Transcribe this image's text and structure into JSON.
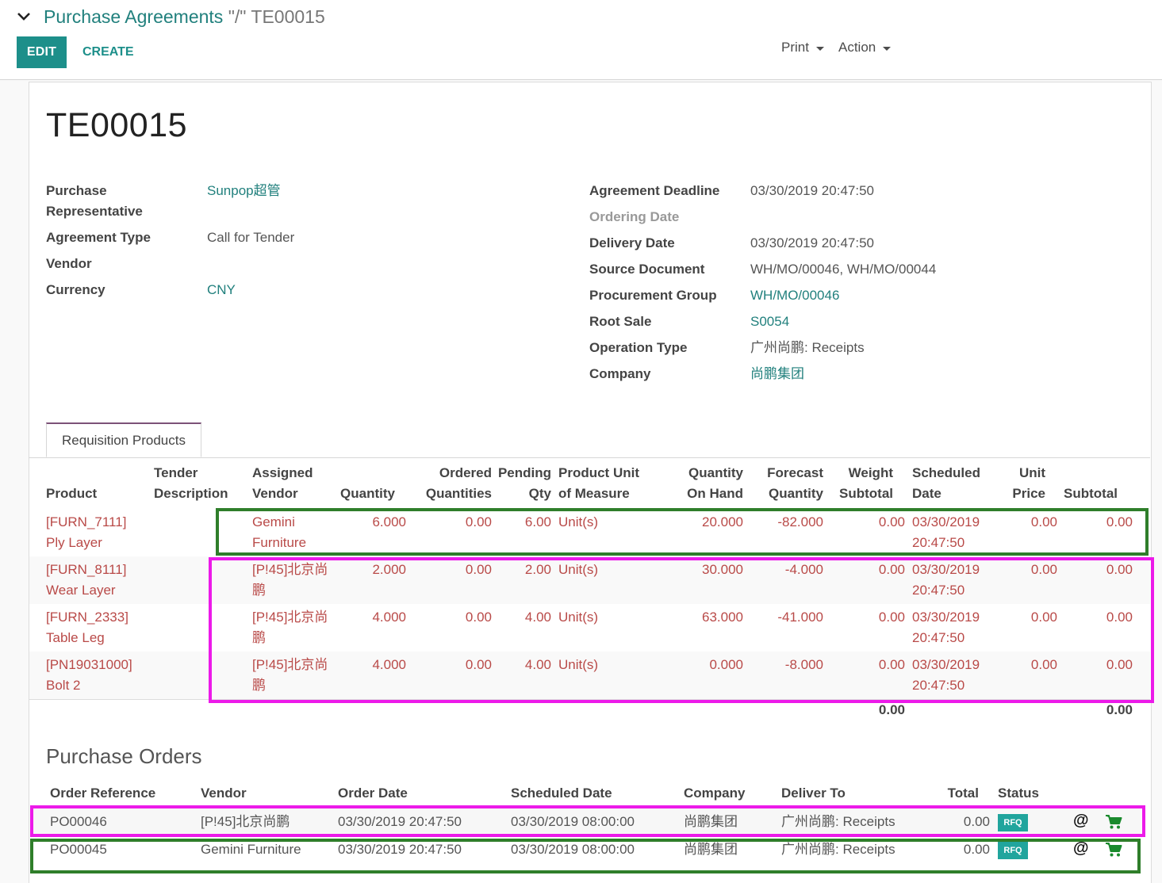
{
  "breadcrumb": {
    "parent": "Purchase Agreements",
    "separator": "\"/\"",
    "current": "TE00015"
  },
  "toolbar": {
    "edit_label": "EDIT",
    "create_label": "CREATE",
    "print_label": "Print",
    "action_label": "Action"
  },
  "record": {
    "name": "TE00015",
    "left_fields": [
      {
        "label": "Purchase\nRepresentative",
        "value": "Sunpop超管",
        "is_link": true
      },
      {
        "label": "Agreement Type",
        "value": "Call for Tender",
        "is_link": false
      },
      {
        "label": "Vendor",
        "value": "",
        "is_link": false
      },
      {
        "label": "Currency",
        "value": "CNY",
        "is_link": true
      }
    ],
    "right_fields": [
      {
        "label": "Agreement Deadline",
        "value": "03/30/2019 20:47:50",
        "is_link": false
      },
      {
        "label": "Ordering Date",
        "value": "",
        "is_link": false
      },
      {
        "label": "Delivery Date",
        "value": "03/30/2019 20:47:50",
        "is_link": false
      },
      {
        "label": "Source Document",
        "value": "WH/MO/00046, WH/MO/00044",
        "is_link": false
      },
      {
        "label": "Procurement Group",
        "value": "WH/MO/00046",
        "is_link": true
      },
      {
        "label": "Root Sale",
        "value": "S0054",
        "is_link": true
      },
      {
        "label": "Operation Type",
        "value": "广州尚鹏: Receipts",
        "is_link": false
      },
      {
        "label": "Company",
        "value": "尚鹏集团",
        "is_link": true
      }
    ]
  },
  "tab": {
    "label": "Requisition Products"
  },
  "lines_table": {
    "headers": {
      "product": "Product",
      "tender_description": "Tender\nDescription",
      "assigned_vendor": "Assigned\nVendor",
      "quantity": "Quantity",
      "ordered_quantities": "Ordered\nQuantities",
      "pending_qty": "Pending\nQty",
      "uom": "Product Unit\nof Measure",
      "qty_on_hand": "Quantity\nOn Hand",
      "forecast_quantity": "Forecast\nQuantity",
      "weight_subtotal": "Weight\nSubtotal",
      "scheduled_date": "Scheduled\nDate",
      "unit_price": "Unit\nPrice",
      "subtotal": "Subtotal"
    },
    "rows": [
      {
        "product": "[FURN_7111]\nPly Layer",
        "vendor": "Gemini\nFurniture",
        "quantity": "6.000",
        "ordered": "0.00",
        "pending": "6.00",
        "uom": "Unit(s)",
        "on_hand": "20.000",
        "forecast": "-82.000",
        "weight": "0.00",
        "date": "03/30/2019\n20:47:50",
        "unit_price": "0.00",
        "subtotal": "0.00"
      },
      {
        "product": "[FURN_8111]\nWear Layer",
        "vendor": "[P!45]北京尚\n鹏",
        "quantity": "2.000",
        "ordered": "0.00",
        "pending": "2.00",
        "uom": "Unit(s)",
        "on_hand": "30.000",
        "forecast": "-4.000",
        "weight": "0.00",
        "date": "03/30/2019\n20:47:50",
        "unit_price": "0.00",
        "subtotal": "0.00"
      },
      {
        "product": "[FURN_2333]\nTable Leg",
        "vendor": "[P!45]北京尚\n鹏",
        "quantity": "4.000",
        "ordered": "0.00",
        "pending": "4.00",
        "uom": "Unit(s)",
        "on_hand": "63.000",
        "forecast": "-41.000",
        "weight": "0.00",
        "date": "03/30/2019\n20:47:50",
        "unit_price": "0.00",
        "subtotal": "0.00"
      },
      {
        "product": "[PN19031000]\nBolt 2",
        "vendor": "[P!45]北京尚\n鹏",
        "quantity": "4.000",
        "ordered": "0.00",
        "pending": "4.00",
        "uom": "Unit(s)",
        "on_hand": "0.000",
        "forecast": "-8.000",
        "weight": "0.00",
        "date": "03/30/2019\n20:47:50",
        "unit_price": "0.00",
        "subtotal": "0.00"
      }
    ],
    "totals": {
      "weight": "0.00",
      "subtotal": "0.00"
    }
  },
  "purchase_orders": {
    "title": "Purchase Orders",
    "headers": {
      "reference": "Order Reference",
      "vendor": "Vendor",
      "order_date": "Order Date",
      "scheduled_date": "Scheduled Date",
      "company": "Company",
      "deliver_to": "Deliver To",
      "total": "Total",
      "status": "Status"
    },
    "rows": [
      {
        "reference": "PO00046",
        "vendor": "[P!45]北京尚鹏",
        "order_date": "03/30/2019 20:47:50",
        "scheduled_date": "03/30/2019 08:00:00",
        "company": "尚鹏集团",
        "deliver_to": "广州尚鹏: Receipts",
        "total": "0.00",
        "status": "RFQ",
        "mail_icon": "at-sign-icon",
        "cart_icon": "shopping-cart-icon"
      },
      {
        "reference": "PO00045",
        "vendor": "Gemini Furniture",
        "order_date": "03/30/2019 20:47:50",
        "scheduled_date": "03/30/2019 08:00:00",
        "company": "尚鹏集团",
        "deliver_to": "广州尚鹏: Receipts",
        "total": "0.00",
        "status": "RFQ",
        "mail_icon": "at-sign-icon",
        "cart_icon": "shopping-cart-icon"
      }
    ]
  },
  "colors": {
    "primary": "#1d8f8a",
    "link": "#21807d",
    "line_text": "#b94a48",
    "tab_accent": "#7c5278",
    "highlight_green": "#2f7e2a",
    "highlight_magenta": "#ec1ae9",
    "status_badge": "#21a59d"
  }
}
